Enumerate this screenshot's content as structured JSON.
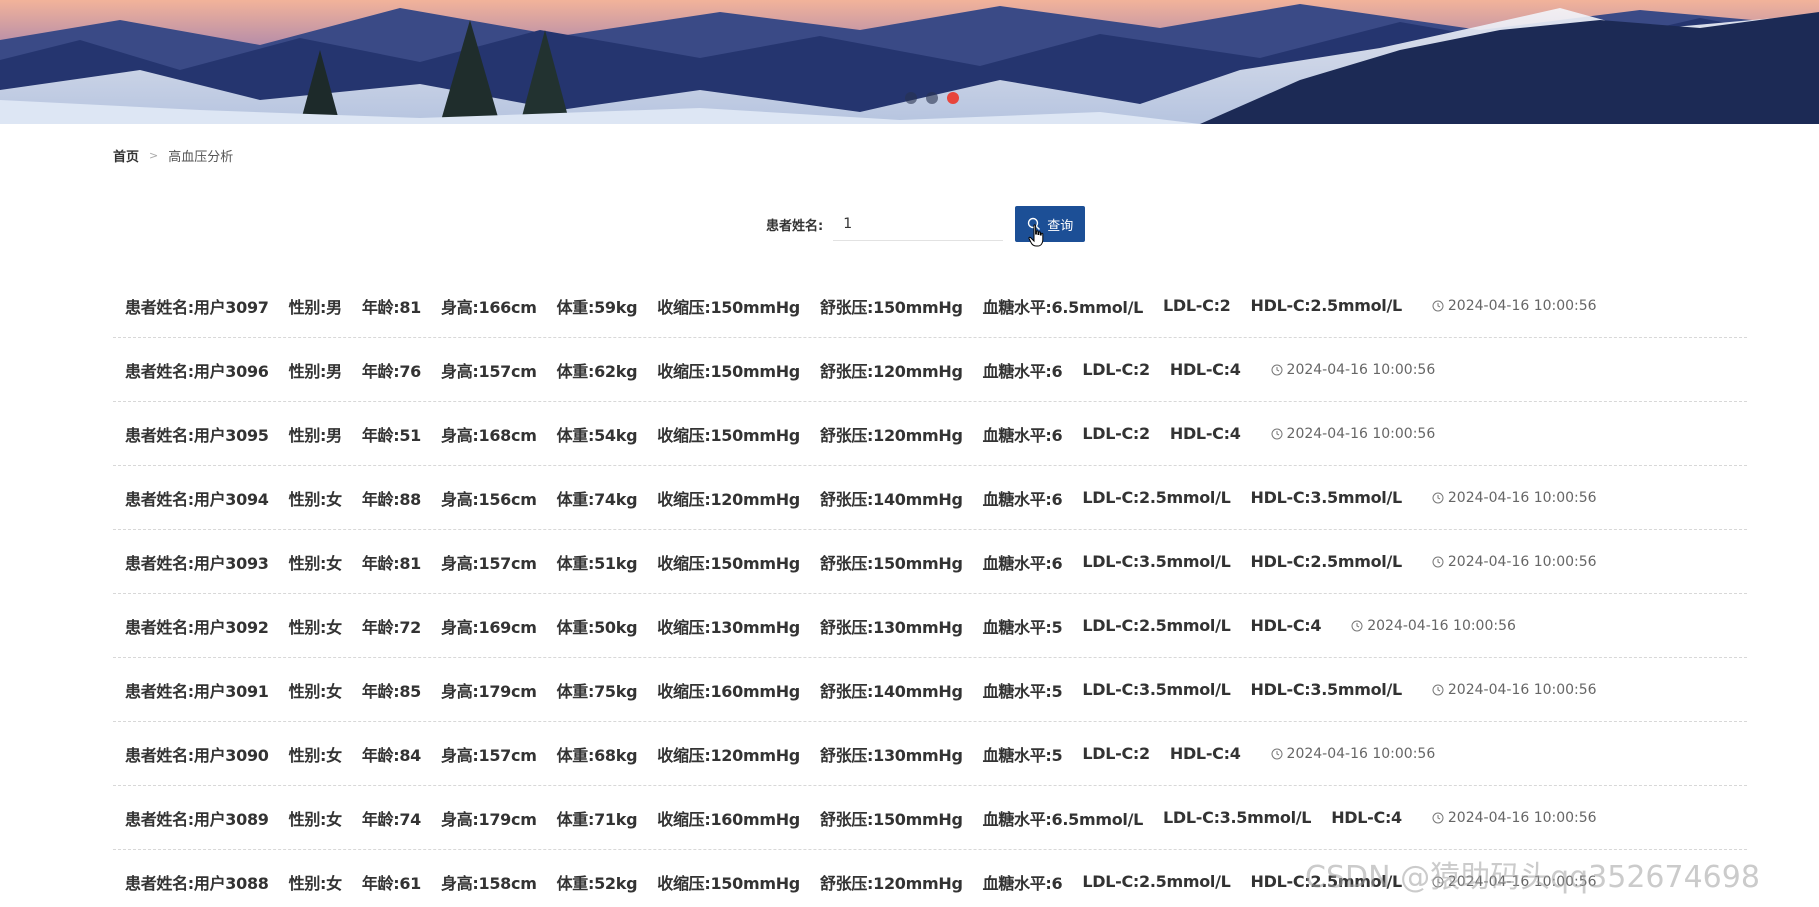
{
  "carousel": {
    "slide_count": 3,
    "active_index": 2
  },
  "breadcrumb": {
    "home": "首页",
    "separator": ">",
    "current": "高血压分析"
  },
  "search": {
    "label": "患者姓名:",
    "value": "1",
    "button_label": "查询"
  },
  "records": [
    {
      "name": "患者姓名:用户3097",
      "gender": "性别:男",
      "age": "年龄:81",
      "height": "身高:166cm",
      "weight": "体重:59kg",
      "systolic": "收缩压:150mmHg",
      "diastolic": "舒张压:150mmHg",
      "glucose": "血糖水平:6.5mmol/L",
      "ldl": "LDL-C:2",
      "hdl": "HDL-C:2.5mmol/L",
      "time": "2024-04-16 10:00:56"
    },
    {
      "name": "患者姓名:用户3096",
      "gender": "性别:男",
      "age": "年龄:76",
      "height": "身高:157cm",
      "weight": "体重:62kg",
      "systolic": "收缩压:150mmHg",
      "diastolic": "舒张压:120mmHg",
      "glucose": "血糖水平:6",
      "ldl": "LDL-C:2",
      "hdl": "HDL-C:4",
      "time": "2024-04-16 10:00:56"
    },
    {
      "name": "患者姓名:用户3095",
      "gender": "性别:男",
      "age": "年龄:51",
      "height": "身高:168cm",
      "weight": "体重:54kg",
      "systolic": "收缩压:150mmHg",
      "diastolic": "舒张压:120mmHg",
      "glucose": "血糖水平:6",
      "ldl": "LDL-C:2",
      "hdl": "HDL-C:4",
      "time": "2024-04-16 10:00:56"
    },
    {
      "name": "患者姓名:用户3094",
      "gender": "性别:女",
      "age": "年龄:88",
      "height": "身高:156cm",
      "weight": "体重:74kg",
      "systolic": "收缩压:120mmHg",
      "diastolic": "舒张压:140mmHg",
      "glucose": "血糖水平:6",
      "ldl": "LDL-C:2.5mmol/L",
      "hdl": "HDL-C:3.5mmol/L",
      "time": "2024-04-16 10:00:56"
    },
    {
      "name": "患者姓名:用户3093",
      "gender": "性别:女",
      "age": "年龄:81",
      "height": "身高:157cm",
      "weight": "体重:51kg",
      "systolic": "收缩压:150mmHg",
      "diastolic": "舒张压:150mmHg",
      "glucose": "血糖水平:6",
      "ldl": "LDL-C:3.5mmol/L",
      "hdl": "HDL-C:2.5mmol/L",
      "time": "2024-04-16 10:00:56"
    },
    {
      "name": "患者姓名:用户3092",
      "gender": "性别:女",
      "age": "年龄:72",
      "height": "身高:169cm",
      "weight": "体重:50kg",
      "systolic": "收缩压:130mmHg",
      "diastolic": "舒张压:130mmHg",
      "glucose": "血糖水平:5",
      "ldl": "LDL-C:2.5mmol/L",
      "hdl": "HDL-C:4",
      "time": "2024-04-16 10:00:56"
    },
    {
      "name": "患者姓名:用户3091",
      "gender": "性别:女",
      "age": "年龄:85",
      "height": "身高:179cm",
      "weight": "体重:75kg",
      "systolic": "收缩压:160mmHg",
      "diastolic": "舒张压:140mmHg",
      "glucose": "血糖水平:5",
      "ldl": "LDL-C:3.5mmol/L",
      "hdl": "HDL-C:3.5mmol/L",
      "time": "2024-04-16 10:00:56"
    },
    {
      "name": "患者姓名:用户3090",
      "gender": "性别:女",
      "age": "年龄:84",
      "height": "身高:157cm",
      "weight": "体重:68kg",
      "systolic": "收缩压:120mmHg",
      "diastolic": "舒张压:130mmHg",
      "glucose": "血糖水平:5",
      "ldl": "LDL-C:2",
      "hdl": "HDL-C:4",
      "time": "2024-04-16 10:00:56"
    },
    {
      "name": "患者姓名:用户3089",
      "gender": "性别:女",
      "age": "年龄:74",
      "height": "身高:179cm",
      "weight": "体重:71kg",
      "systolic": "收缩压:160mmHg",
      "diastolic": "舒张压:150mmHg",
      "glucose": "血糖水平:6.5mmol/L",
      "ldl": "LDL-C:3.5mmol/L",
      "hdl": "HDL-C:4",
      "time": "2024-04-16 10:00:56"
    },
    {
      "name": "患者姓名:用户3088",
      "gender": "性别:女",
      "age": "年龄:61",
      "height": "身高:158cm",
      "weight": "体重:52kg",
      "systolic": "收缩压:150mmHg",
      "diastolic": "舒张压:120mmHg",
      "glucose": "血糖水平:6",
      "ldl": "LDL-C:2.5mmol/L",
      "hdl": "HDL-C:2.5mmol/L",
      "time": "2024-04-16 10:00:56"
    }
  ],
  "watermark": "CSDN @猿助码头qq352674698",
  "colors": {
    "accent": "#1c4f96",
    "active_dot": "#e8453c"
  },
  "icons": {
    "search": "search-icon",
    "clock": "clock-icon",
    "cursor": "hand-cursor-icon"
  }
}
